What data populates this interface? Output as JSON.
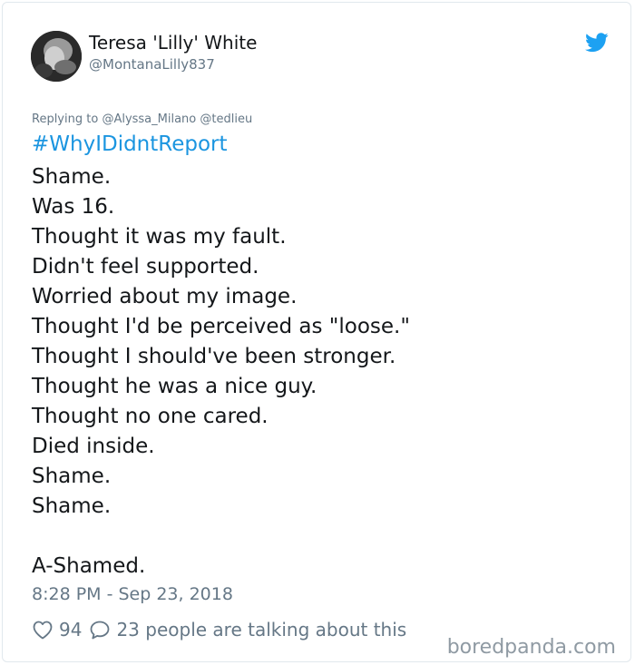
{
  "tweet": {
    "author_name": "Teresa 'Lilly' White",
    "author_handle": "@MontanaLilly837",
    "replying_prefix": "Replying to",
    "replying_to": [
      "@Alyssa_Milano",
      "@tedlieu"
    ],
    "hashtag": "#WhyIDidntReport",
    "lines": [
      "Shame.",
      "Was 16.",
      "Thought it was my fault.",
      "Didn't feel supported.",
      "Worried about my image.",
      "Thought I'd be perceived as \"loose.\"",
      "Thought I should've been stronger.",
      "Thought he was a nice guy.",
      "Thought no one cared.",
      "Died inside.",
      "Shame.",
      "Shame.",
      "",
      "A-Shamed."
    ],
    "timestamp": "8:28 PM - Sep 23, 2018",
    "likes": "94",
    "replies": "23 people are talking about this"
  },
  "icons": {
    "brand": "twitter-bird-icon",
    "like": "heart-icon",
    "reply": "comment-icon"
  },
  "colors": {
    "link": "#1b95e0",
    "muted": "#657786",
    "text": "#14171a",
    "watermark": "#8f9aa3"
  },
  "watermark": "boredpanda.com"
}
